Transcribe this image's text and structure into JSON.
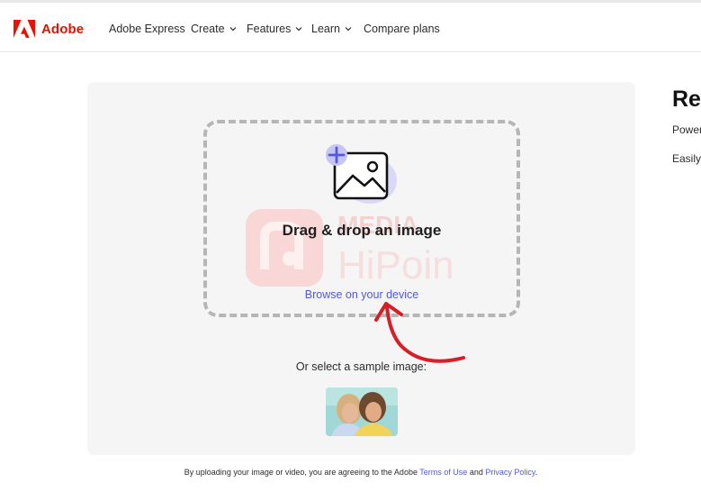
{
  "header": {
    "brand": "Adobe",
    "nav": [
      {
        "label": "Adobe Express",
        "has_dropdown": false
      },
      {
        "label": "Create",
        "has_dropdown": true
      },
      {
        "label": "Features",
        "has_dropdown": true
      },
      {
        "label": "Learn",
        "has_dropdown": true
      },
      {
        "label": "Compare plans",
        "has_dropdown": false
      }
    ]
  },
  "upload": {
    "icon": "add-image-icon",
    "title": "Drag & drop an image",
    "browse_link": "Browse on your device",
    "sample_label": "Or select a sample image:",
    "sample_icon": "sample-photo-two-women"
  },
  "watermark": {
    "line1": "MEDIA",
    "line2": "HiPoin"
  },
  "annotation": {
    "arrow_color": "#d61f26"
  },
  "terms": {
    "prefix": "By uploading your image or video, you are agreeing to the Adobe ",
    "terms_link": "Terms of Use",
    "middle": " and ",
    "privacy_link": "Privacy Policy",
    "suffix": "."
  },
  "right_panel": {
    "title": "Re",
    "line1": "Power",
    "line2": "Easily"
  },
  "colors": {
    "brand": "#eb1000",
    "link": "#5258e4",
    "panel_bg": "#f5f5f5",
    "dash": "#b6b6b6"
  }
}
